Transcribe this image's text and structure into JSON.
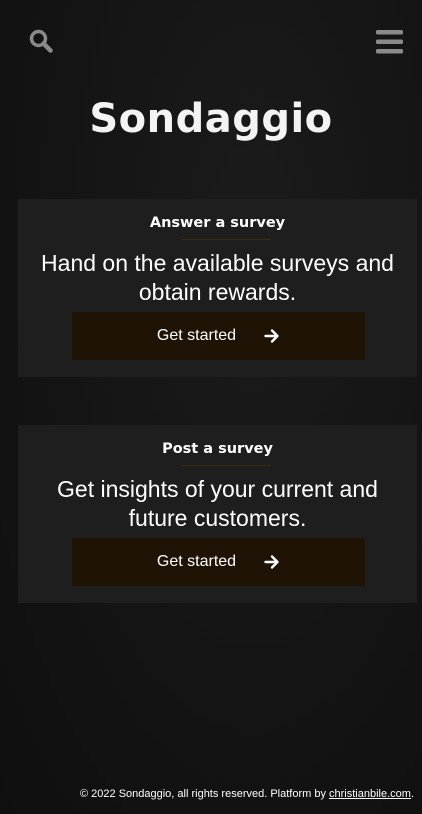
{
  "header": {
    "search_icon": "search-icon",
    "menu_icon": "hamburger-menu-icon"
  },
  "title": "Sondaggio",
  "cards": [
    {
      "heading": "Answer a survey",
      "text": "Hand on the available surveys and obtain rewards.",
      "button_label": "Get started",
      "button_icon": "arrow-right-icon"
    },
    {
      "heading": "Post a survey",
      "text": "Get insights of your current and future customers.",
      "button_label": "Get started",
      "button_icon": "arrow-right-icon"
    }
  ],
  "footer": {
    "text": "© 2022 Sondaggio, all rights reserved. Platform by ",
    "link_text": "christianbile.com",
    "suffix": "."
  },
  "colors": {
    "background": "#141414",
    "card": "#1e1e1e",
    "button": "#1f1306",
    "accent_divider": "#3a2a12",
    "icon_gray": "#8a8a8a"
  }
}
